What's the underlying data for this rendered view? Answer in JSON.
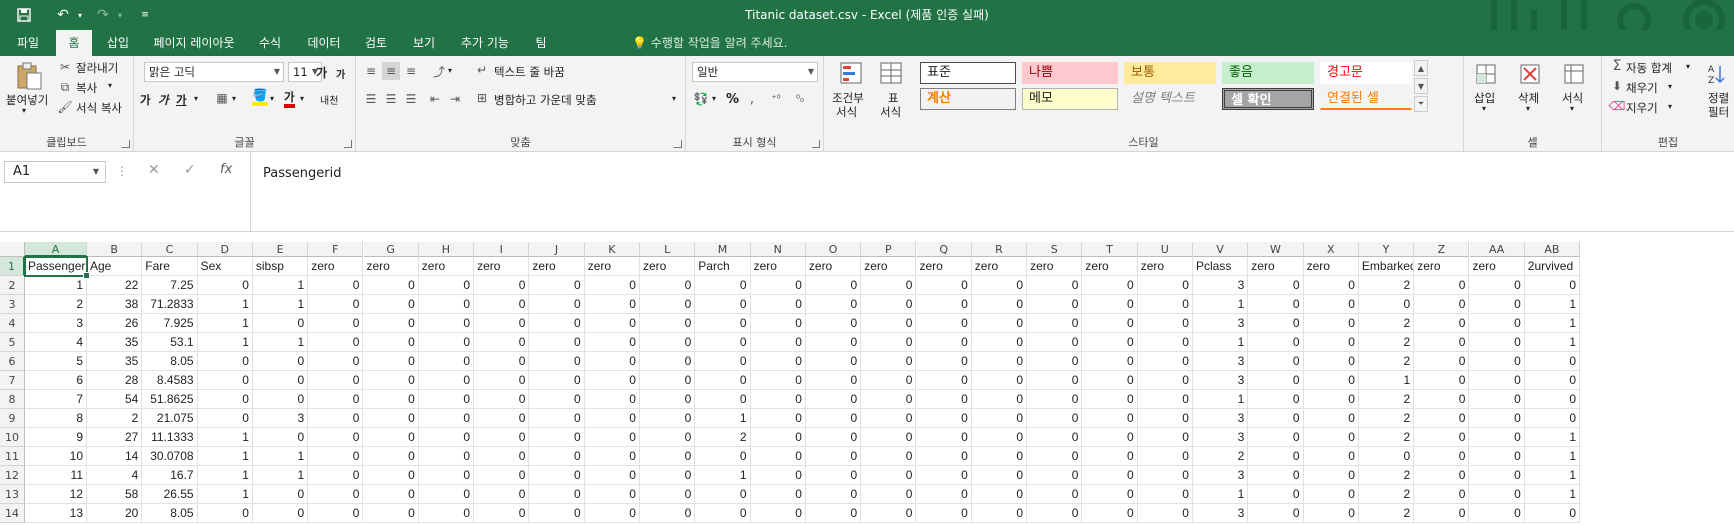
{
  "window": {
    "title": "Titanic dataset.csv - Excel (제품 인증 실패)"
  },
  "colors": {
    "accent": "#217346",
    "selection": "#d3e7da"
  },
  "tabs": [
    {
      "label": "파일",
      "active": false
    },
    {
      "label": "홈",
      "active": true
    },
    {
      "label": "삽입",
      "active": false
    },
    {
      "label": "페이지 레이아웃",
      "active": false
    },
    {
      "label": "수식",
      "active": false
    },
    {
      "label": "데이터",
      "active": false
    },
    {
      "label": "검토",
      "active": false
    },
    {
      "label": "보기",
      "active": false
    },
    {
      "label": "추가 기능",
      "active": false
    },
    {
      "label": "팀",
      "active": false
    }
  ],
  "tell_me": "수행할 작업을 알려 주세요.",
  "ribbon": {
    "clipboard": {
      "paste": "붙여넣기",
      "cut": "잘라내기",
      "copy": "복사",
      "format_painter": "서식 복사",
      "label": "클립보드"
    },
    "font": {
      "name": "맑은 고딕",
      "size": "11",
      "label": "글꼴",
      "increase": "가",
      "decrease": "가",
      "bold": "가",
      "italic": "가",
      "underline": "가",
      "color_letter": "가",
      "phonetic": "내천"
    },
    "alignment": {
      "wrap": "텍스트 줄 바꿈",
      "merge": "병합하고 가운데 맞춤",
      "label": "맞춤"
    },
    "number": {
      "format": "일반",
      "percent": "%",
      "label": "표시 형식"
    },
    "styles": {
      "conditional": "조건부\n서식",
      "conditional_line1": "조건부",
      "conditional_line2": "서식",
      "table_line1": "표",
      "table_line2": "서식",
      "label": "스타일",
      "cells": [
        {
          "text": "표준"
        },
        {
          "text": "나쁨"
        },
        {
          "text": "보통"
        },
        {
          "text": "좋음"
        },
        {
          "text": "경고문"
        },
        {
          "text": "계산"
        },
        {
          "text": "메모"
        },
        {
          "text": "설명 텍스트"
        },
        {
          "text": "셀 확인"
        },
        {
          "text": "연결된 셀"
        }
      ]
    },
    "cells": {
      "insert": "삽입",
      "delete": "삭제",
      "format": "서식",
      "label": "셀"
    },
    "editing": {
      "autosum": "자동 합계",
      "fill": "채우기",
      "clear": "지우기",
      "sort_line1": "정렬",
      "sort_line2": "필터",
      "label": "편집"
    }
  },
  "formula_bar": {
    "name_box": "A1",
    "formula": "Passengerid",
    "cancel": "✕",
    "enter": "✓",
    "fx": "fx"
  },
  "sheet": {
    "columns": [
      "A",
      "B",
      "C",
      "D",
      "E",
      "F",
      "G",
      "H",
      "I",
      "J",
      "K",
      "L",
      "M",
      "N",
      "O",
      "P",
      "Q",
      "R",
      "S",
      "T",
      "U",
      "V",
      "W",
      "X",
      "Y",
      "Z",
      "AA",
      "AB"
    ],
    "rows": [
      [
        "Passengerid",
        "Age",
        "Fare",
        "Sex",
        "sibsp",
        "zero",
        "zero",
        "zero",
        "zero",
        "zero",
        "zero",
        "zero",
        "Parch",
        "zero",
        "zero",
        "zero",
        "zero",
        "zero",
        "zero",
        "zero",
        "zero",
        "Pclass",
        "zero",
        "zero",
        "Embarked",
        "zero",
        "zero",
        "2urvived"
      ],
      [
        "1",
        "22",
        "7.25",
        "0",
        "1",
        "0",
        "0",
        "0",
        "0",
        "0",
        "0",
        "0",
        "0",
        "0",
        "0",
        "0",
        "0",
        "0",
        "0",
        "0",
        "0",
        "3",
        "0",
        "0",
        "2",
        "0",
        "0",
        "0"
      ],
      [
        "2",
        "38",
        "71.2833",
        "1",
        "1",
        "0",
        "0",
        "0",
        "0",
        "0",
        "0",
        "0",
        "0",
        "0",
        "0",
        "0",
        "0",
        "0",
        "0",
        "0",
        "0",
        "1",
        "0",
        "0",
        "0",
        "0",
        "0",
        "1"
      ],
      [
        "3",
        "26",
        "7.925",
        "1",
        "0",
        "0",
        "0",
        "0",
        "0",
        "0",
        "0",
        "0",
        "0",
        "0",
        "0",
        "0",
        "0",
        "0",
        "0",
        "0",
        "0",
        "3",
        "0",
        "0",
        "2",
        "0",
        "0",
        "1"
      ],
      [
        "4",
        "35",
        "53.1",
        "1",
        "1",
        "0",
        "0",
        "0",
        "0",
        "0",
        "0",
        "0",
        "0",
        "0",
        "0",
        "0",
        "0",
        "0",
        "0",
        "0",
        "0",
        "1",
        "0",
        "0",
        "2",
        "0",
        "0",
        "1"
      ],
      [
        "5",
        "35",
        "8.05",
        "0",
        "0",
        "0",
        "0",
        "0",
        "0",
        "0",
        "0",
        "0",
        "0",
        "0",
        "0",
        "0",
        "0",
        "0",
        "0",
        "0",
        "0",
        "3",
        "0",
        "0",
        "2",
        "0",
        "0",
        "0"
      ],
      [
        "6",
        "28",
        "8.4583",
        "0",
        "0",
        "0",
        "0",
        "0",
        "0",
        "0",
        "0",
        "0",
        "0",
        "0",
        "0",
        "0",
        "0",
        "0",
        "0",
        "0",
        "0",
        "3",
        "0",
        "0",
        "1",
        "0",
        "0",
        "0"
      ],
      [
        "7",
        "54",
        "51.8625",
        "0",
        "0",
        "0",
        "0",
        "0",
        "0",
        "0",
        "0",
        "0",
        "0",
        "0",
        "0",
        "0",
        "0",
        "0",
        "0",
        "0",
        "0",
        "1",
        "0",
        "0",
        "2",
        "0",
        "0",
        "0"
      ],
      [
        "8",
        "2",
        "21.075",
        "0",
        "3",
        "0",
        "0",
        "0",
        "0",
        "0",
        "0",
        "0",
        "1",
        "0",
        "0",
        "0",
        "0",
        "0",
        "0",
        "0",
        "0",
        "3",
        "0",
        "0",
        "2",
        "0",
        "0",
        "0"
      ],
      [
        "9",
        "27",
        "11.1333",
        "1",
        "0",
        "0",
        "0",
        "0",
        "0",
        "0",
        "0",
        "0",
        "2",
        "0",
        "0",
        "0",
        "0",
        "0",
        "0",
        "0",
        "0",
        "3",
        "0",
        "0",
        "2",
        "0",
        "0",
        "1"
      ],
      [
        "10",
        "14",
        "30.0708",
        "1",
        "1",
        "0",
        "0",
        "0",
        "0",
        "0",
        "0",
        "0",
        "0",
        "0",
        "0",
        "0",
        "0",
        "0",
        "0",
        "0",
        "0",
        "2",
        "0",
        "0",
        "0",
        "0",
        "0",
        "1"
      ],
      [
        "11",
        "4",
        "16.7",
        "1",
        "1",
        "0",
        "0",
        "0",
        "0",
        "0",
        "0",
        "0",
        "1",
        "0",
        "0",
        "0",
        "0",
        "0",
        "0",
        "0",
        "0",
        "3",
        "0",
        "0",
        "2",
        "0",
        "0",
        "1"
      ],
      [
        "12",
        "58",
        "26.55",
        "1",
        "0",
        "0",
        "0",
        "0",
        "0",
        "0",
        "0",
        "0",
        "0",
        "0",
        "0",
        "0",
        "0",
        "0",
        "0",
        "0",
        "0",
        "1",
        "0",
        "0",
        "2",
        "0",
        "0",
        "1"
      ],
      [
        "13",
        "20",
        "8.05",
        "0",
        "0",
        "0",
        "0",
        "0",
        "0",
        "0",
        "0",
        "0",
        "0",
        "0",
        "0",
        "0",
        "0",
        "0",
        "0",
        "0",
        "0",
        "3",
        "0",
        "0",
        "2",
        "0",
        "0",
        "0"
      ]
    ]
  }
}
